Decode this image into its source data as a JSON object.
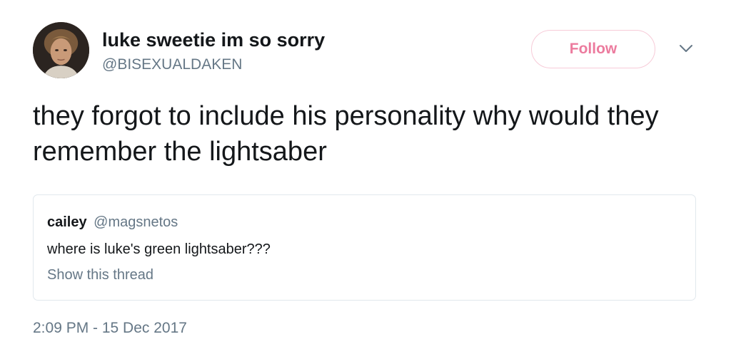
{
  "author": {
    "display_name": "luke sweetie im so sorry",
    "handle": "@BISEXUALDAKEN",
    "avatar_icon": "profile-photo"
  },
  "actions": {
    "follow_label": "Follow",
    "more_icon": "chevron-down-icon"
  },
  "tweet": {
    "text": "they forgot to include his personality why would they remember the lightsaber",
    "timestamp": "2:09 PM - 15 Dec 2017"
  },
  "quoted_tweet": {
    "name": "cailey",
    "handle": "@magsnetos",
    "text": "where is luke's green lightsaber???",
    "thread_link": "Show this thread"
  },
  "colors": {
    "accent": "#e0245e",
    "secondary_text": "#657786",
    "primary_text": "#14171a",
    "border": "#e1e8ed"
  }
}
